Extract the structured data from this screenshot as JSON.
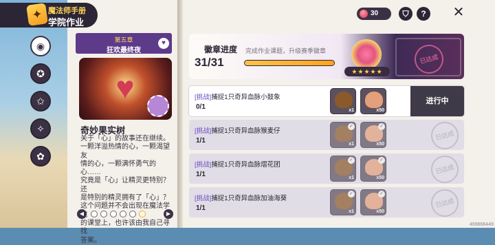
{
  "header": {
    "app_name": "魔法师手册",
    "page_title": "学院作业"
  },
  "rail": {
    "items": [
      "book-icon",
      "crest-icon",
      "star-badge-icon",
      "magic-icon",
      "flower-icon"
    ]
  },
  "chapter": {
    "number": "第五章",
    "name": "狂欢最终夜",
    "icon": "heart-icon"
  },
  "story": {
    "title": "奇妙果实树",
    "lines": [
      "关于「心」的故事还在继续。",
      "一颗洋溢热情的心，一颗渴望友",
      "情的心，一颗满怀勇气的心……",
      "究竟是「心」让精灵更特别？还",
      "是特别的精灵拥有了「心」？",
      "这个问题并不会出现在魔法学院",
      "的课堂上，也许该由我自己寻找",
      "答案。"
    ]
  },
  "pager": {
    "prev": "◀",
    "next": "▶",
    "dots": 6
  },
  "topbar": {
    "currency_value": "30",
    "currency_icon": "gem-icon",
    "cart_icon": "cart-icon",
    "help_label": "?",
    "close_label": "✕"
  },
  "badge": {
    "title": "徽章进度",
    "subtitle": "完成作业课题，升级赛季徽章",
    "progress_text": "31/31",
    "progress_fraction": 1.0,
    "stars": "★★★★★",
    "stamp_label": "已达成"
  },
  "tasks": [
    {
      "tag": "[挑战]",
      "text": "捕捉1只奇异血脉小鼓象",
      "count": "0/1",
      "status": "进行中",
      "done": false,
      "rewards": [
        "x1",
        "x50"
      ]
    },
    {
      "tag": "[挑战]",
      "text": "捕捉1只奇异血脉猴麦仔",
      "count": "1/1",
      "status": "已达成",
      "done": true,
      "rewards": [
        "x1",
        "x50"
      ]
    },
    {
      "tag": "[挑战]",
      "text": "捕捉1只奇异血脉熠花团",
      "count": "1/1",
      "status": "已达成",
      "done": true,
      "rewards": [
        "x1",
        "x50"
      ]
    },
    {
      "tag": "[挑战]",
      "text": "捕捉1只奇异血脉加油海葵",
      "count": "1/1",
      "status": "已达成",
      "done": true,
      "rewards": [
        "x1",
        "x50"
      ]
    }
  ],
  "footer": {
    "uid": "469866449"
  },
  "colors": {
    "accent_purple": "#5e3a8a",
    "progress": "#ffa21f",
    "panel_dark": "#3f3a47"
  }
}
